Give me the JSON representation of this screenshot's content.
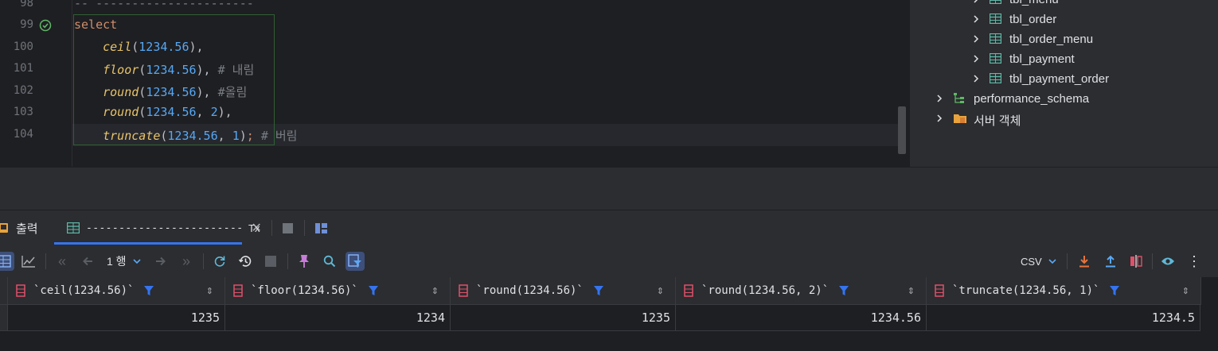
{
  "editor": {
    "lines": [
      {
        "num": "98",
        "text": "-- ----------------------"
      },
      {
        "num": "99"
      },
      {
        "num": "100"
      },
      {
        "num": "101"
      },
      {
        "num": "102"
      },
      {
        "num": "103"
      },
      {
        "num": "104"
      }
    ],
    "code": {
      "select": "select",
      "l100_fn": "ceil",
      "l100_num": "1234.56",
      "l101_fn": "floor",
      "l101_num": "1234.56",
      "l101_comment": "# 내림",
      "l102_fn": "round",
      "l102_num": "1234.56",
      "l102_comment": "#올림",
      "l103_fn": "round",
      "l103_num1": "1234.56",
      "l103_num2": "2",
      "l104_fn": "truncate",
      "l104_num1": "1234.56",
      "l104_num2": "1",
      "l104_comment": "# 버림"
    }
  },
  "tree": {
    "items": [
      {
        "label": "tbl_menu"
      },
      {
        "label": "tbl_order"
      },
      {
        "label": "tbl_order_menu"
      },
      {
        "label": "tbl_payment"
      },
      {
        "label": "tbl_payment_order"
      }
    ],
    "schema": "performance_schema",
    "server_objects": "서버 객체"
  },
  "tabs": {
    "output": "출력",
    "result": "------------------------",
    "tx": "Tx"
  },
  "toolbar": {
    "rows": "1 행",
    "export_format": "CSV"
  },
  "grid": {
    "columns": [
      "`ceil(1234.56)`",
      "`floor(1234.56)`",
      "`round(1234.56)`",
      "`round(1234.56, 2)`",
      "`truncate(1234.56, 1)`"
    ],
    "rows": [
      [
        "1235",
        "1234",
        "1235",
        "1234.56",
        "1234.5"
      ]
    ]
  },
  "colors": {
    "accent": "#3574f0",
    "keyword": "#cf8e6d",
    "function": "#e8c46a",
    "number": "#56a8f5",
    "comment": "#7a7e85"
  }
}
